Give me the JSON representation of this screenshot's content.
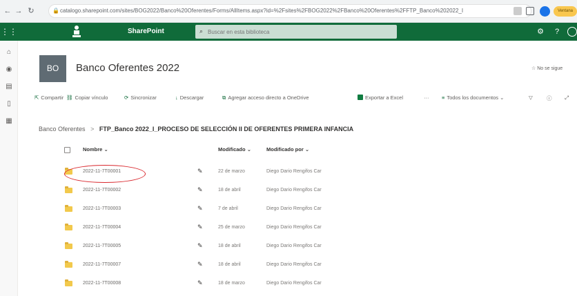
{
  "browser": {
    "url": "catalogo.sharepoint.com/sites/BOG2022/Banco%20Oferentes/Forms/AllItems.aspx?id=%2Fsites%2FBOG2022%2FBanco%20Oferentes%2FFTP_Banco%202022_I",
    "profile_label": "Ventana"
  },
  "suite": {
    "app_name": "SharePoint",
    "search_placeholder": "Buscar en esta biblioteca"
  },
  "site": {
    "logo_initials": "BO",
    "title": "Banco Oferentes 2022",
    "follow_label": "No se sigue"
  },
  "commands": {
    "share": "Compartir",
    "copy_link": "Copiar vínculo",
    "sync": "Sincronizar",
    "download": "Descargar",
    "add_shortcut": "Agregar acceso directo a OneDrive",
    "export_excel": "Exportar a Excel",
    "more": "···",
    "view": "Todos los documentos"
  },
  "breadcrumb": {
    "parent": "Banco Oferentes",
    "separator": ">",
    "current": "FTP_Banco 2022_I_PROCESO DE SELECCIÓN II DE OFERENTES PRIMERA INFANCIA"
  },
  "table": {
    "headers": {
      "name": "Nombre",
      "modified": "Modificado",
      "modified_by": "Modificado por"
    },
    "rows": [
      {
        "name": "2022-11-7T00001",
        "modified": "22 de marzo",
        "modified_by": "Diego Dario Rengifos Car"
      },
      {
        "name": "2022-11-7T00002",
        "modified": "18 de abril",
        "modified_by": "Diego Dario Rengifos Car"
      },
      {
        "name": "2022-11-7T00003",
        "modified": "7 de abril",
        "modified_by": "Diego Dario Rengifos Car"
      },
      {
        "name": "2022-11-7T00004",
        "modified": "25 de marzo",
        "modified_by": "Diego Dario Rengifos Car"
      },
      {
        "name": "2022-11-7T00005",
        "modified": "18 de abril",
        "modified_by": "Diego Dario Rengifos Car"
      },
      {
        "name": "2022-11-7T00007",
        "modified": "18 de abril",
        "modified_by": "Diego Dario Rengifos Car"
      },
      {
        "name": "2022-11-7T00008",
        "modified": "18 de marzo",
        "modified_by": "Diego Dario Rengifos Car"
      }
    ]
  },
  "colors": {
    "suite_bar": "#106b3a",
    "highlight": "#d9262c",
    "folder": "#f2c94c"
  }
}
